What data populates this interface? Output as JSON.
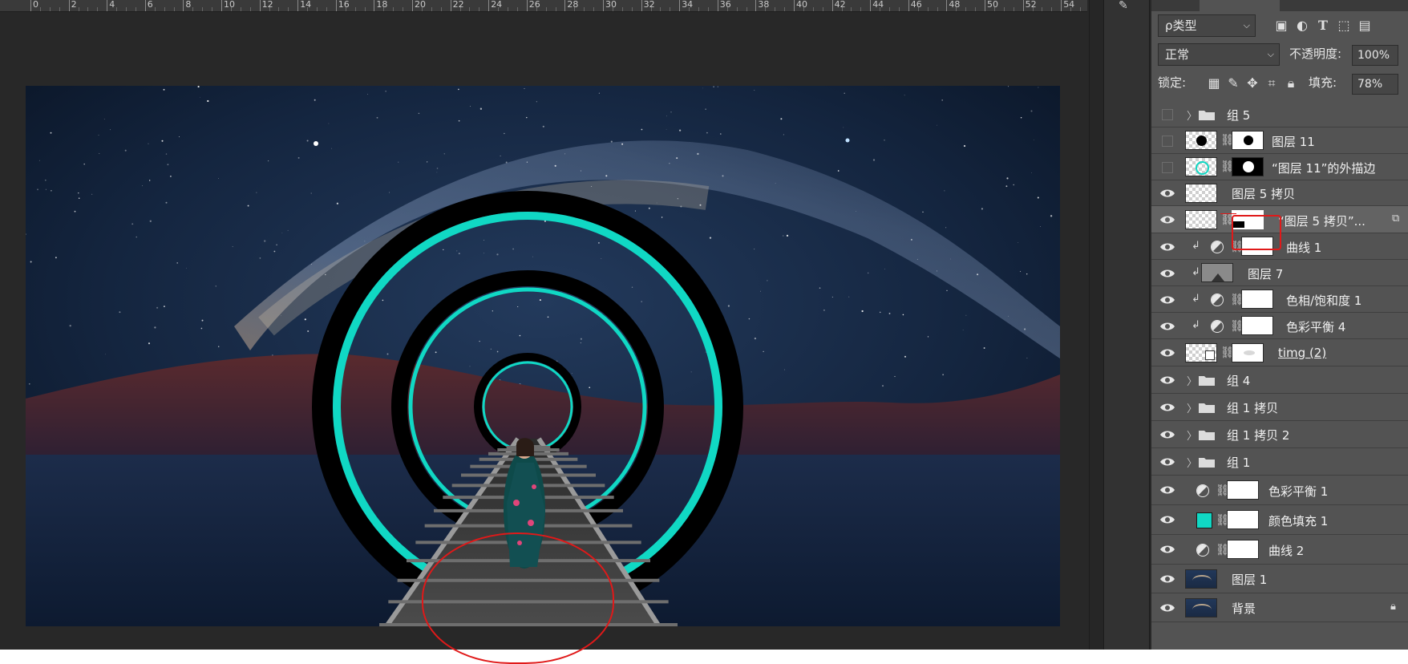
{
  "ruler": {
    "labels": [
      "0",
      "2",
      "4",
      "6",
      "8",
      "10",
      "12",
      "14",
      "16",
      "18",
      "20",
      "22",
      "24",
      "26",
      "28",
      "30",
      "32",
      "34",
      "36",
      "38",
      "40",
      "42",
      "44",
      "46",
      "48",
      "50",
      "52",
      "54"
    ]
  },
  "panel": {
    "filter_label": "ρ类型",
    "blend_mode": "正常",
    "opacity_label": "不透明度:",
    "opacity_value": "100%",
    "lock_label": "锁定:",
    "fill_label": "填充:",
    "fill_value": "78%"
  },
  "layers": [
    {
      "name": "组 5",
      "visible": false,
      "kind": "group"
    },
    {
      "name": "图层 11",
      "visible": false,
      "kind": "layer-mask"
    },
    {
      "name": "“图层 11”的外描边",
      "visible": false,
      "kind": "layer-mask"
    },
    {
      "name": "图层 5 拷贝",
      "visible": true,
      "kind": "layer"
    },
    {
      "name": "“图层 5 拷贝”...",
      "visible": true,
      "kind": "layer-mask",
      "selected": true
    },
    {
      "name": "曲线 1",
      "visible": true,
      "kind": "adjustment",
      "clipped": true
    },
    {
      "name": "图层 7",
      "visible": true,
      "kind": "layer",
      "clipped": true
    },
    {
      "name": "色相/饱和度 1",
      "visible": true,
      "kind": "adjustment",
      "clipped": true
    },
    {
      "name": "色彩平衡 4",
      "visible": true,
      "kind": "adjustment",
      "clipped": true
    },
    {
      "name": "timg (2)",
      "visible": true,
      "kind": "smart-mask"
    },
    {
      "name": "组 4",
      "visible": true,
      "kind": "group"
    },
    {
      "name": "组 1 拷贝",
      "visible": true,
      "kind": "group"
    },
    {
      "name": "组 1 拷贝 2",
      "visible": true,
      "kind": "group"
    },
    {
      "name": "组 1",
      "visible": true,
      "kind": "group"
    },
    {
      "name": "色彩平衡 1",
      "visible": true,
      "kind": "adjustment"
    },
    {
      "name": "颜色填充 1",
      "visible": true,
      "kind": "fill"
    },
    {
      "name": "曲线 2",
      "visible": true,
      "kind": "adjustment"
    },
    {
      "name": "图层 1",
      "visible": true,
      "kind": "photo"
    },
    {
      "name": "背景",
      "visible": true,
      "kind": "background"
    }
  ],
  "colors": {
    "ring": "#10d8c4",
    "annotation": "#e01919"
  }
}
